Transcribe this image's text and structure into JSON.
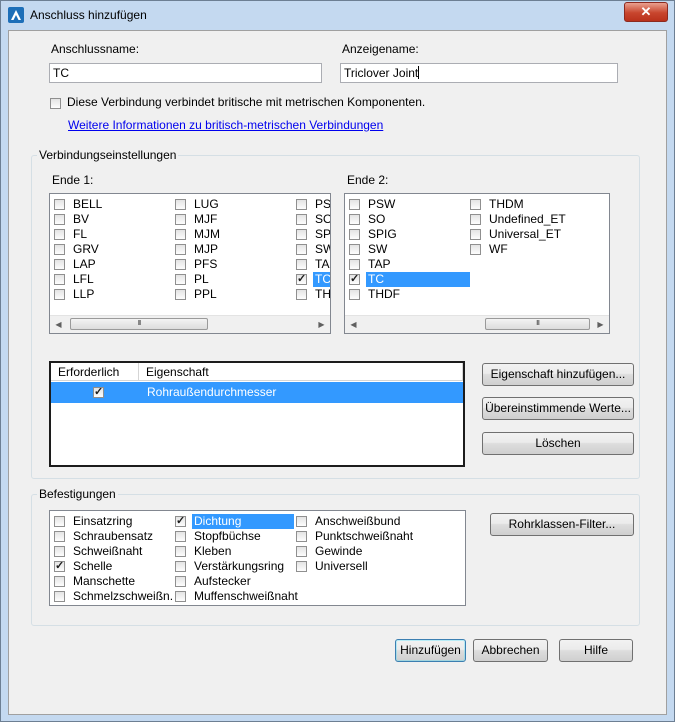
{
  "window": {
    "title": "Anschluss hinzufügen",
    "close_glyph": "✕",
    "icon": "autocad-app-icon"
  },
  "fields": {
    "name_label": "Anschlussname:",
    "name_value": "TC",
    "display_label": "Anzeigename:",
    "display_value": "Triclover Joint"
  },
  "imperial_metric": {
    "checkbox_label": "Diese Verbindung verbindet britische mit metrischen Komponenten.",
    "checked": false,
    "link_text": "Weitere Informationen zu britisch-metrischen Verbindungen"
  },
  "connection_settings": {
    "group_title": "Verbindungseinstellungen",
    "end1": {
      "label": "Ende 1:",
      "columns": [
        [
          {
            "label": "BELL",
            "checked": false
          },
          {
            "label": "BV",
            "checked": false
          },
          {
            "label": "FL",
            "checked": false
          },
          {
            "label": "GRV",
            "checked": false
          },
          {
            "label": "LAP",
            "checked": false
          },
          {
            "label": "LFL",
            "checked": false
          },
          {
            "label": "LLP",
            "checked": false
          }
        ],
        [
          {
            "label": "LUG",
            "checked": false
          },
          {
            "label": "MJF",
            "checked": false
          },
          {
            "label": "MJM",
            "checked": false
          },
          {
            "label": "MJP",
            "checked": false
          },
          {
            "label": "PFS",
            "checked": false
          },
          {
            "label": "PL",
            "checked": false
          },
          {
            "label": "PPL",
            "checked": false
          }
        ],
        [
          {
            "label": "PSW",
            "checked": false
          },
          {
            "label": "SO",
            "checked": false
          },
          {
            "label": "SPIG",
            "checked": false
          },
          {
            "label": "SW",
            "checked": false
          },
          {
            "label": "TAP",
            "checked": false
          },
          {
            "label": "TC",
            "checked": true,
            "selected": true
          },
          {
            "label": "THDF",
            "checked": false
          }
        ]
      ]
    },
    "end2": {
      "label": "Ende 2:",
      "columns": [
        [
          {
            "label": "PSW",
            "checked": false
          },
          {
            "label": "SO",
            "checked": false
          },
          {
            "label": "SPIG",
            "checked": false
          },
          {
            "label": "SW",
            "checked": false
          },
          {
            "label": "TAP",
            "checked": false
          },
          {
            "label": "TC",
            "checked": true,
            "selected": true
          },
          {
            "label": "THDF",
            "checked": false
          }
        ],
        [
          {
            "label": "THDM",
            "checked": false
          },
          {
            "label": "Undefined_ET",
            "checked": false
          },
          {
            "label": "Universal_ET",
            "checked": false
          },
          {
            "label": "WF",
            "checked": false
          }
        ]
      ]
    },
    "scroll_thumb_glyph": "III",
    "scroll_left_glyph": "◀",
    "scroll_right_glyph": "▶",
    "property_table": {
      "headers": [
        "Erforderlich",
        "Eigenschaft"
      ],
      "rows": [
        {
          "required": true,
          "property": "Rohraußendurchmesser"
        }
      ]
    },
    "buttons": {
      "add_property": "Eigenschaft hinzufügen...",
      "matching_values": "Übereinstimmende Werte...",
      "delete": "Löschen"
    }
  },
  "fasteners": {
    "group_title": "Befestigungen",
    "columns": [
      [
        {
          "label": "Einsatzring",
          "checked": false
        },
        {
          "label": "Schraubensatz",
          "checked": false
        },
        {
          "label": "Schweißnaht",
          "checked": false
        },
        {
          "label": "Schelle",
          "checked": true
        },
        {
          "label": "Manschette",
          "checked": false
        },
        {
          "label": "Schmelzschweißn.",
          "checked": false
        }
      ],
      [
        {
          "label": "Dichtung",
          "checked": true,
          "selected": true
        },
        {
          "label": "Stopfbüchse",
          "checked": false
        },
        {
          "label": "Kleben",
          "checked": false
        },
        {
          "label": "Verstärkungsring",
          "checked": false
        },
        {
          "label": "Aufstecker",
          "checked": false
        },
        {
          "label": "Muffenschweißnaht",
          "checked": false
        }
      ],
      [
        {
          "label": "Anschweißbund",
          "checked": false
        },
        {
          "label": "Punktschweißnaht",
          "checked": false
        },
        {
          "label": "Gewinde",
          "checked": false
        },
        {
          "label": "Universell",
          "checked": false
        }
      ]
    ],
    "filter_button": "Rohrklassen-Filter..."
  },
  "footer": {
    "add": "Hinzufügen",
    "cancel": "Abbrechen",
    "help": "Hilfe"
  }
}
